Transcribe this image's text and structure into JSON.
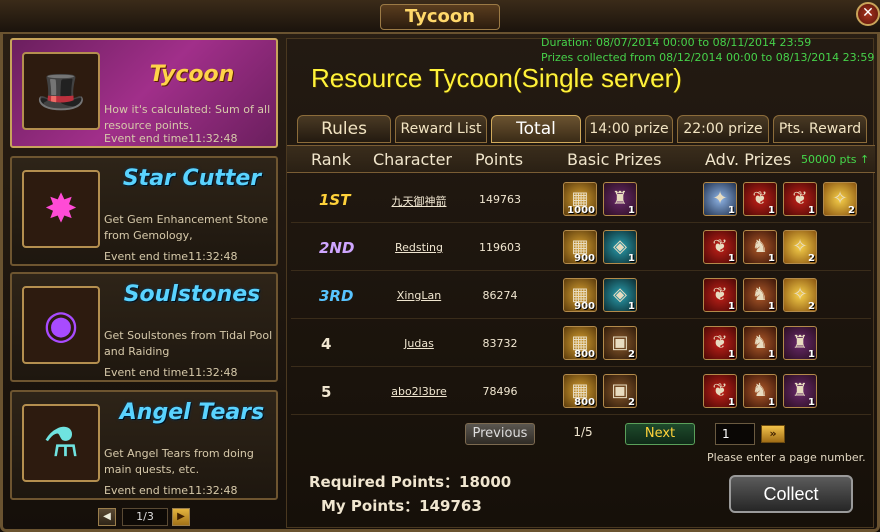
{
  "window": {
    "title": "Tycoon"
  },
  "sidebar": {
    "events": [
      {
        "name": "Tycoon",
        "desc": "How it's calculated: Sum of all resource points.",
        "end": "Event end time11:32:48",
        "icon": "tycoon-portrait"
      },
      {
        "name": "Star Cutter",
        "desc": "Get Gem Enhancement Stone from Gemology,",
        "end": "Event end time11:32:48",
        "icon": "star-gem"
      },
      {
        "name": "Soulstones",
        "desc": "Get Soulstones from Tidal Pool and Raiding",
        "end": "Event end time11:32:48",
        "icon": "soul-orb"
      },
      {
        "name": "Angel Tears",
        "desc": "Get Angel Tears from doing main quests, etc.",
        "end": "Event end time11:32:48",
        "icon": "potion-vial"
      }
    ],
    "pager": {
      "prev": "◀",
      "page": "1/3",
      "next": "▶"
    }
  },
  "main": {
    "duration": "Duration: 08/07/2014 00:00 to 08/11/2014 23:59",
    "collected": "Prizes collected from 08/12/2014 00:00 to 08/13/2014 23:59",
    "title": "Resource Tycoon(Single server)",
    "tabs": [
      "Rules",
      "Reward List",
      "Total",
      "14:00 prize",
      "22:00 prize",
      "Pts. Reward"
    ],
    "active_tab": "Total",
    "headers": {
      "rank": "Rank",
      "character": "Character",
      "points": "Points",
      "basic": "Basic Prizes",
      "adv": "Adv. Prizes",
      "pts_note": "50000 pts ↑"
    },
    "rows": [
      {
        "rank": "1ST",
        "character": "九天御神箭",
        "points": "149763",
        "basic": [
          {
            "k": "gold",
            "q": "1000"
          },
          {
            "k": "fig",
            "q": "1"
          }
        ],
        "adv": [
          {
            "k": "wolf",
            "q": "1"
          },
          {
            "k": "red",
            "q": "1"
          },
          {
            "k": "red",
            "q": "1"
          },
          {
            "k": "yel",
            "q": "2"
          }
        ]
      },
      {
        "rank": "2ND",
        "character": "Redsting",
        "points": "119603",
        "basic": [
          {
            "k": "gold",
            "q": "900"
          },
          {
            "k": "teal",
            "q": "1"
          }
        ],
        "adv": [
          {
            "k": "red",
            "q": "1"
          },
          {
            "k": "warr",
            "q": "1"
          },
          {
            "k": "yel",
            "q": "2"
          }
        ]
      },
      {
        "rank": "3RD",
        "character": "XingLan",
        "points": "86274",
        "basic": [
          {
            "k": "gold",
            "q": "900"
          },
          {
            "k": "teal",
            "q": "1"
          }
        ],
        "adv": [
          {
            "k": "red",
            "q": "1"
          },
          {
            "k": "warr",
            "q": "1"
          },
          {
            "k": "yel",
            "q": "2"
          }
        ]
      },
      {
        "rank": "4",
        "character": "Judas",
        "points": "83732",
        "basic": [
          {
            "k": "gold",
            "q": "800"
          },
          {
            "k": "chest",
            "q": "2"
          }
        ],
        "adv": [
          {
            "k": "red",
            "q": "1"
          },
          {
            "k": "warr",
            "q": "1"
          },
          {
            "k": "fig",
            "q": "1"
          }
        ]
      },
      {
        "rank": "5",
        "character": "abo2l3bre",
        "points": "78496",
        "basic": [
          {
            "k": "gold",
            "q": "800"
          },
          {
            "k": "chest",
            "q": "2"
          }
        ],
        "adv": [
          {
            "k": "red",
            "q": "1"
          },
          {
            "k": "warr",
            "q": "1"
          },
          {
            "k": "fig",
            "q": "1"
          }
        ]
      }
    ],
    "pager": {
      "previous": "Previous",
      "page": "1/5",
      "next": "Next",
      "input": "1",
      "go": "»"
    },
    "hint": "Please enter a page number.",
    "required": "Required Points：18000",
    "my_points": "My Points：149763",
    "collect": "Collect"
  }
}
